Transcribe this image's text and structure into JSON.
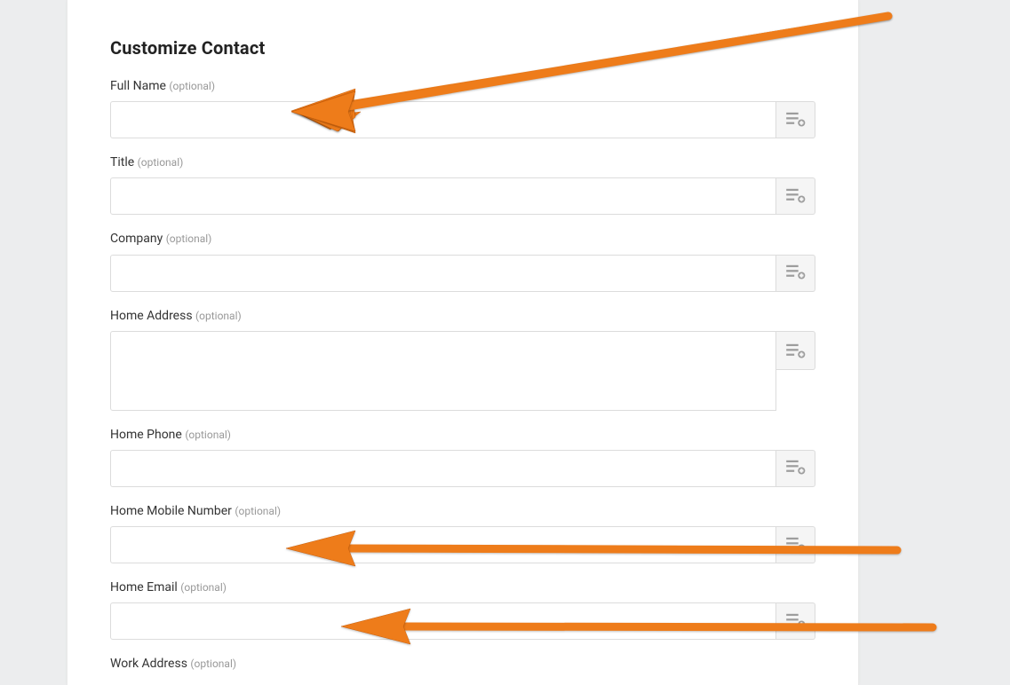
{
  "page_title": "Customize Contact",
  "optional_hint": "(optional)",
  "fields": [
    {
      "label": "Full Name",
      "type": "text",
      "value": ""
    },
    {
      "label": "Title",
      "type": "text",
      "value": ""
    },
    {
      "label": "Company",
      "type": "text",
      "value": ""
    },
    {
      "label": "Home Address",
      "type": "textarea",
      "value": ""
    },
    {
      "label": "Home Phone",
      "type": "text",
      "value": ""
    },
    {
      "label": "Home Mobile Number",
      "type": "text",
      "value": ""
    },
    {
      "label": "Home Email",
      "type": "text",
      "value": ""
    },
    {
      "label": "Work Address",
      "type": "textarea_label_only",
      "value": ""
    }
  ]
}
